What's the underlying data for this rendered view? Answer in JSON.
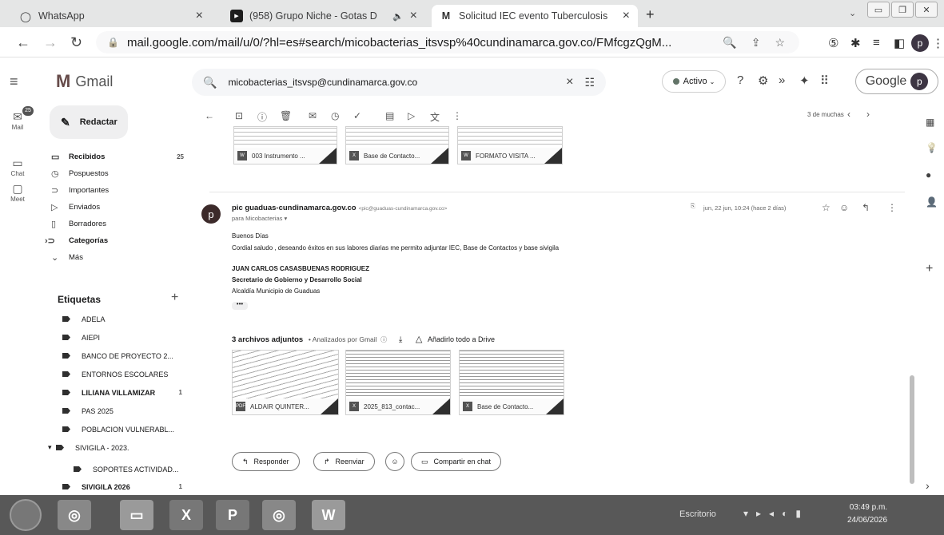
{
  "tabs": [
    {
      "title": "WhatsApp",
      "icon": "whatsapp-icon"
    },
    {
      "title": "(958) Grupo Niche - Gotas D",
      "icon": "youtube-icon"
    },
    {
      "title": "Solicitud IEC evento Tuberculosis",
      "icon": "gmail-icon"
    }
  ],
  "address": {
    "url": "mail.google.com/mail/u/0/?hl=es#search/micobacterias_itsvsp%40cundinamarca.gov.co/FMfcgzQgM..."
  },
  "gmail": {
    "brand": "Gmail",
    "search_query": "micobacterias_itsvsp@cundinamarca.gov.co",
    "status": "Activo",
    "account": "Google",
    "avatar_letter": "p"
  },
  "rail": {
    "mail": "Mail",
    "chat": "Chat",
    "meet": "Meet",
    "mail_badge": "25"
  },
  "sidebar": {
    "compose": "Redactar",
    "items": [
      {
        "label": "Recibidos",
        "count": "25"
      },
      {
        "label": "Pospuestos",
        "count": ""
      },
      {
        "label": "Importantes",
        "count": ""
      },
      {
        "label": "Enviados",
        "count": ""
      },
      {
        "label": "Borradores",
        "count": ""
      },
      {
        "label": "Categorías",
        "count": ""
      },
      {
        "label": "Más",
        "count": ""
      }
    ],
    "labels_title": "Etiquetas",
    "labels": [
      {
        "label": "ADELA",
        "count": ""
      },
      {
        "label": "AIEPI",
        "count": ""
      },
      {
        "label": "BANCO DE PROYECTO 2...",
        "count": ""
      },
      {
        "label": "ENTORNOS ESCOLARES",
        "count": ""
      },
      {
        "label": "LILIANA VILLAMIZAR",
        "count": "1"
      },
      {
        "label": "PAS 2025",
        "count": ""
      },
      {
        "label": "POBLACION VULNERABL...",
        "count": ""
      },
      {
        "label": "SIVIGILA - 2023.",
        "count": ""
      },
      {
        "label": "SOPORTES ACTIVIDAD...",
        "count": ""
      },
      {
        "label": "SIVIGILA 2026",
        "count": "1"
      }
    ]
  },
  "pager": "3 de muchas",
  "prev_attachments": [
    "003 Instrumento ...",
    "Base de Contacto...",
    "FORMATO VISITA ..."
  ],
  "message": {
    "sender_avatar": "p",
    "sender_name": "pic guaduas-cundinamarca.gov.co",
    "sender_email": "<pic@guaduas-cundinamarca.gov.co>",
    "to": "para Micobacterias",
    "date": "jun, 22 jun, 10:24 (hace 2 días)",
    "greeting": "Buenos Días",
    "body": "Cordial saludo , deseando éxitos en sus labores diarias me permito adjuntar IEC, Base de Contactos y base sivigila",
    "sig_name": "JUAN CARLOS CASASBUENAS RODRIGUEZ",
    "sig_title": "Secretario de Gobierno y Desarrollo Social",
    "sig_org": "Alcaldía Municipio de Guaduas",
    "ellipsis": "•••",
    "attach_count": "3 archivos adjuntos",
    "attach_scan": "• Analizados por Gmail",
    "attach_drive": "Añadirlo todo a Drive",
    "attachments": [
      {
        "name": "ALDAIR QUINTER...",
        "type": "PDF"
      },
      {
        "name": "2025_813_contac...",
        "type": "X"
      },
      {
        "name": "Base de Contacto...",
        "type": "X"
      }
    ]
  },
  "actions": {
    "reply": "Responder",
    "forward": "Reenviar",
    "share": "Compartir en chat"
  },
  "taskbar": {
    "desktop": "Escritorio",
    "time": "03:49 p.m.",
    "date": "24/06/2026"
  }
}
